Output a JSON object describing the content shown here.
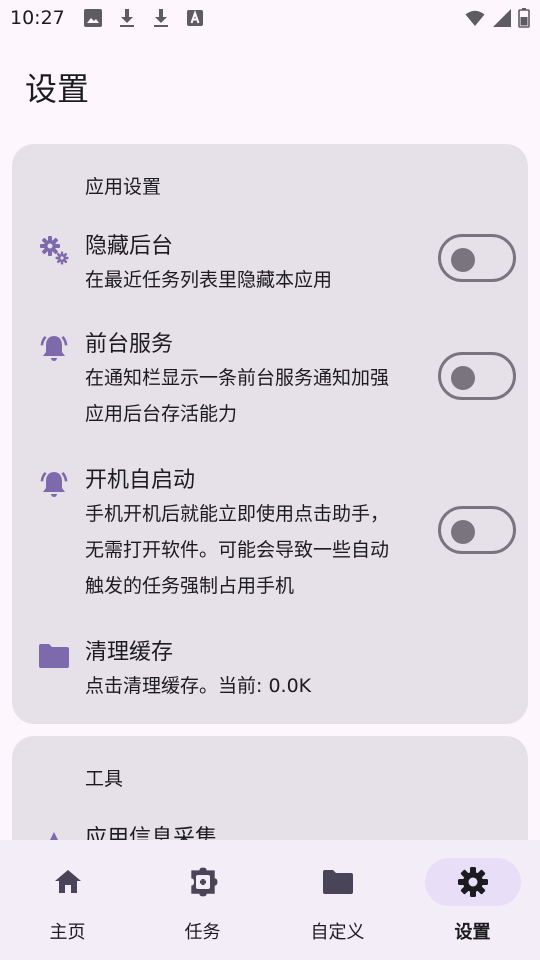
{
  "status_bar": {
    "time": "10:27",
    "left_icons": [
      "image-icon",
      "download-icon",
      "download-icon",
      "text-icon"
    ],
    "right_icons": [
      "wifi-icon",
      "signal-icon",
      "battery-icon"
    ]
  },
  "page": {
    "title": "设置"
  },
  "app_settings": {
    "section_title": "应用设置",
    "items": [
      {
        "title": "隐藏后台",
        "desc": [
          "在最近任务列表里隐藏本应用"
        ],
        "icon": "gears-icon",
        "toggle_on": false
      },
      {
        "title": "前台服务",
        "desc": [
          "在通知栏显示一条前台服务通知加强",
          "应用后台存活能力"
        ],
        "icon": "bell-ringing-icon",
        "toggle_on": false
      },
      {
        "title": "开机自启动",
        "desc": [
          "手机开机后就能立即使用点击助手，",
          "无需打开软件。可能会导致一些自动",
          "触发的任务强制占用手机"
        ],
        "icon": "bell-ringing-icon",
        "toggle_on": false
      },
      {
        "title": "清理缓存",
        "desc": [
          "点击清理缓存。当前: 0.0K"
        ],
        "icon": "folder-icon"
      }
    ]
  },
  "tools": {
    "section_title": "工具",
    "items": [
      {
        "title": "应用信息采集",
        "icon": "triangle-icon"
      }
    ]
  },
  "bottom_nav": {
    "items": [
      {
        "label": "主页",
        "icon": "home-icon",
        "active": false
      },
      {
        "label": "任务",
        "icon": "puzzle-icon",
        "active": false
      },
      {
        "label": "自定义",
        "icon": "folder-icon",
        "active": false
      },
      {
        "label": "设置",
        "icon": "gear-icon",
        "active": true
      }
    ]
  },
  "colors": {
    "background": "#fdf7fd",
    "card": "#e6e0e8",
    "accent": "#7d6aac",
    "outline": "#79747e",
    "nav_active": "#e8def8"
  }
}
